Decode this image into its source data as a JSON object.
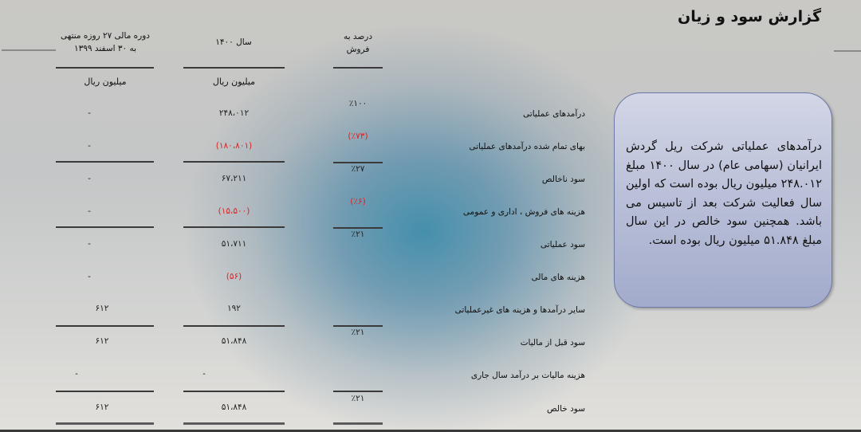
{
  "title": "گزارش سود و زیان",
  "columns": {
    "pct_header": "درصد به فروش",
    "pct_header_line1": "درصد به",
    "pct_header_line2": "فروش",
    "y1400_header": "سال ۱۴۰۰",
    "period_header_line1": "دوره مالی ۲۷ روزه منتهی",
    "period_header_line2": "به ۳۰ اسفند ۱۳۹۹",
    "y1400_unit": "میلیون ریال",
    "period_unit": "میلیون ریال"
  },
  "rows": [
    {
      "label": "درآمدهای عملیاتی",
      "pct": "٪۱۰۰",
      "y1400": "۲۴۸،۰۱۲",
      "period": "-"
    },
    {
      "label": "بهای تمام شده درآمدهای عملیاتی",
      "pct": "(٪۷۳)",
      "y1400": "(۱۸۰،۸۰۱)",
      "period": "-"
    },
    {
      "label": "سود ناخالص",
      "pct": "٪۲۷",
      "y1400": "۶۷،۲۱۱",
      "period": "-"
    },
    {
      "label": "هزینه های فروش ، اداری و عمومی",
      "pct": "(٪۶)",
      "y1400": "(۱۵،۵۰۰)",
      "period": "-"
    },
    {
      "label": "سود عملیاتی",
      "pct": "٪۲۱",
      "y1400": "۵۱،۷۱۱",
      "period": "-"
    },
    {
      "label": "هزینه های مالی",
      "pct": "",
      "y1400": "(۵۶)",
      "period": "-"
    },
    {
      "label": "سایر درآمدها و هزینه های غیرعملیاتی",
      "pct": "",
      "y1400": "۱۹۲",
      "period": "۶۱۲"
    },
    {
      "label": "سود قبل از مالیات",
      "pct": "٪۲۱",
      "y1400": "۵۱،۸۴۸",
      "period": "۶۱۲"
    },
    {
      "label": "هزینه مالیات بر درآمد سال جاری",
      "pct": "",
      "y1400": "-",
      "period": "-"
    },
    {
      "label": "سود خالص",
      "pct": "٪۲۱",
      "y1400": "۵۱،۸۴۸",
      "period": "۶۱۲"
    }
  ],
  "note": "درآمدهای عملیاتی شرکت ریل گردش ایرانیان (سهامی عام) در سال ۱۴۰۰ مبلغ ۲۴۸.۰۱۲ میلیون ریال بوده است که اولین سال فعالیت شرکت بعد از تاسیس می باشد. همچنین سود خالص در این سال مبلغ ۵۱.۸۴۸ میلیون ریال بوده است.",
  "colors": {
    "negative": "#e02020",
    "note_border": "#6b78a8",
    "note_fill": "#b9bfd8"
  }
}
